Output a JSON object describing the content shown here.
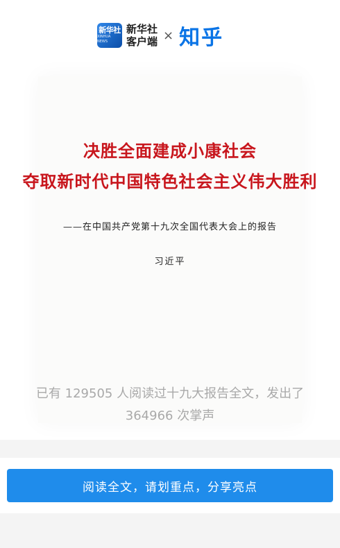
{
  "header": {
    "xinhua_logo_text": "新华社",
    "xinhua_logo_sub": "XINHUA NEWS",
    "xinhua_name_line1": "新华社",
    "xinhua_name_line2": "客户端",
    "times": "×",
    "partner": "知乎"
  },
  "document": {
    "title_line1": "决胜全面建成小康社会",
    "title_line2": "夺取新时代中国特色社会主义伟大胜利",
    "subtitle": "——在中国共产党第十九次全国代表大会上的报告",
    "author": "习近平"
  },
  "stats": {
    "line1": "已有 129505 人阅读过十九大报告全文，发出了",
    "line2": "364966 次掌声"
  },
  "cta": {
    "label": "阅读全文，请划重点，分享亮点"
  },
  "colors": {
    "accent": "#1f8ceb",
    "title_red": "#c8161d",
    "zhihu_blue": "#0a74e6"
  }
}
